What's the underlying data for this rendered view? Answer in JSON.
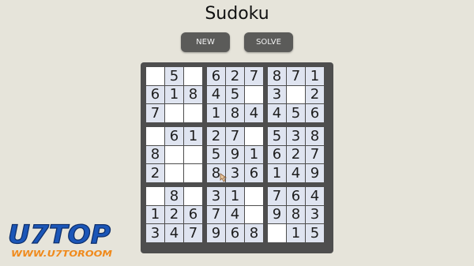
{
  "title": "Sudoku",
  "buttons": {
    "new": "NEW",
    "solve": "SOLVE"
  },
  "grid": [
    [
      "",
      "5",
      "",
      "6",
      "2",
      "7",
      "8",
      "7",
      "1"
    ],
    [
      "6",
      "1",
      "8",
      "4",
      "5",
      "",
      "3",
      "",
      "2"
    ],
    [
      "7",
      "",
      "",
      "1",
      "8",
      "4",
      "4",
      "5",
      "6"
    ],
    [
      "",
      "6",
      "1",
      "2",
      "7",
      "",
      "5",
      "3",
      "8"
    ],
    [
      "8",
      "",
      "",
      "5",
      "9",
      "1",
      "6",
      "2",
      "7"
    ],
    [
      "2",
      "",
      "",
      "8",
      "3",
      "6",
      "1",
      "4",
      "9"
    ],
    [
      "",
      "8",
      "",
      "3",
      "1",
      "",
      "7",
      "6",
      "4"
    ],
    [
      "1",
      "2",
      "6",
      "7",
      "4",
      "",
      "9",
      "8",
      "3"
    ],
    [
      "3",
      "4",
      "7",
      "9",
      "6",
      "8",
      "",
      "1",
      "5"
    ]
  ],
  "watermark": {
    "brand": "U7TOP",
    "url": "WWW.U7TOROOM"
  },
  "colors": {
    "background": "#e6e4da",
    "board_frame": "#4e4e4e",
    "given_cell": "#dfe4f0",
    "empty_cell": "#ffffff",
    "button": "#5b5b59",
    "logo_blue": "#1b56b8",
    "logo_orange": "#f08a1c"
  }
}
